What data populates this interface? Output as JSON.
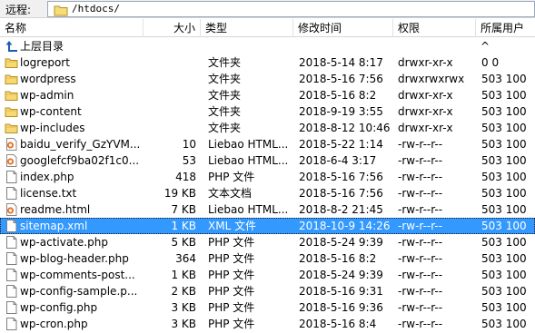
{
  "pathbar": {
    "label": "远程:",
    "path": "/htdocs/"
  },
  "columns": {
    "name": "名称",
    "size": "大小",
    "type": "类型",
    "modified": "修改时间",
    "perms": "权限",
    "owner": "所属用户 ^"
  },
  "parent": {
    "label": "上层目录"
  },
  "rows": [
    {
      "icon": "folder",
      "name": "logreport",
      "size": "",
      "type": "文件夹",
      "date": "2018-5-14 8:17",
      "perms": "drwxr-xr-x",
      "owner": "0 0"
    },
    {
      "icon": "folder",
      "name": "wordpress",
      "size": "",
      "type": "文件夹",
      "date": "2018-5-16 7:56",
      "perms": "drwxrwxrwx",
      "owner": "503 100"
    },
    {
      "icon": "folder",
      "name": "wp-admin",
      "size": "",
      "type": "文件夹",
      "date": "2018-5-16 8:2",
      "perms": "drwxr-xr-x",
      "owner": "503 100"
    },
    {
      "icon": "folder",
      "name": "wp-content",
      "size": "",
      "type": "文件夹",
      "date": "2018-9-19 3:55",
      "perms": "drwxr-xr-x",
      "owner": "503 100"
    },
    {
      "icon": "folder",
      "name": "wp-includes",
      "size": "",
      "type": "文件夹",
      "date": "2018-8-12 10:46",
      "perms": "drwxr-xr-x",
      "owner": "503 100"
    },
    {
      "icon": "html",
      "name": "baidu_verify_GzYVM...",
      "size": "10",
      "type": "Liebao HTML...",
      "date": "2018-5-22 1:14",
      "perms": "-rw-r--r--",
      "owner": "503 100"
    },
    {
      "icon": "html",
      "name": "googlefcf9ba02f1c0...",
      "size": "53",
      "type": "Liebao HTML...",
      "date": "2018-6-4 3:17",
      "perms": "-rw-r--r--",
      "owner": "503 100"
    },
    {
      "icon": "doc",
      "name": "index.php",
      "size": "418",
      "type": "PHP 文件",
      "date": "2018-5-16 7:56",
      "perms": "-rw-r--r--",
      "owner": "503 100"
    },
    {
      "icon": "doc",
      "name": "license.txt",
      "size": "19 KB",
      "type": "文本文档",
      "date": "2018-5-16 7:56",
      "perms": "-rw-r--r--",
      "owner": "503 100"
    },
    {
      "icon": "html",
      "name": "readme.html",
      "size": "7 KB",
      "type": "Liebao HTML...",
      "date": "2018-8-2 21:45",
      "perms": "-rw-r--r--",
      "owner": "503 100"
    },
    {
      "icon": "doc",
      "name": "sitemap.xml",
      "size": "1 KB",
      "type": "XML 文件",
      "date": "2018-10-9 14:26",
      "perms": "-rw-r--r--",
      "owner": "503 100",
      "selected": true
    },
    {
      "icon": "doc",
      "name": "wp-activate.php",
      "size": "5 KB",
      "type": "PHP 文件",
      "date": "2018-5-24 9:39",
      "perms": "-rw-r--r--",
      "owner": "503 100"
    },
    {
      "icon": "doc",
      "name": "wp-blog-header.php",
      "size": "364",
      "type": "PHP 文件",
      "date": "2018-5-16 8:2",
      "perms": "-rw-r--r--",
      "owner": "503 100"
    },
    {
      "icon": "doc",
      "name": "wp-comments-post...",
      "size": "1 KB",
      "type": "PHP 文件",
      "date": "2018-5-24 9:39",
      "perms": "-rw-r--r--",
      "owner": "503 100"
    },
    {
      "icon": "doc",
      "name": "wp-config-sample.p...",
      "size": "2 KB",
      "type": "PHP 文件",
      "date": "2018-5-16 9:31",
      "perms": "-rw-r--r--",
      "owner": "503 100"
    },
    {
      "icon": "doc",
      "name": "wp-config.php",
      "size": "3 KB",
      "type": "PHP 文件",
      "date": "2018-5-16 9:36",
      "perms": "-rw-r--r--",
      "owner": "503 100"
    },
    {
      "icon": "doc",
      "name": "wp-cron.php",
      "size": "3 KB",
      "type": "PHP 文件",
      "date": "2018-5-16 8:4",
      "perms": "-rw-r--r--",
      "owner": "503 100"
    }
  ]
}
